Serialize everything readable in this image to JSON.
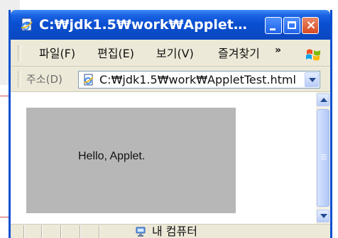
{
  "window": {
    "title": "C:₩jdk1.5₩work₩AppletTe...",
    "colors": {
      "titlebar": "#0a4fd1",
      "chrome": "#ece9d8",
      "applet_background": "#b7b7b7"
    }
  },
  "menu": {
    "items": [
      {
        "label": "파일(F)"
      },
      {
        "label": "편집(E)"
      },
      {
        "label": "보기(V)"
      },
      {
        "label": "즐겨찾기"
      }
    ],
    "more_label": "»"
  },
  "address": {
    "label": "주소(D)",
    "value": "C:₩jdk1.5₩work₩AppletTest.html"
  },
  "applet": {
    "text": "Hello, Applet."
  },
  "status": {
    "zone_label": "내 컴퓨터"
  },
  "icons": {
    "window_icon": "ie-page-icon",
    "address_icon": "page-icon",
    "zone_icon": "computer-icon",
    "throbber": "windows-flag-icon"
  }
}
